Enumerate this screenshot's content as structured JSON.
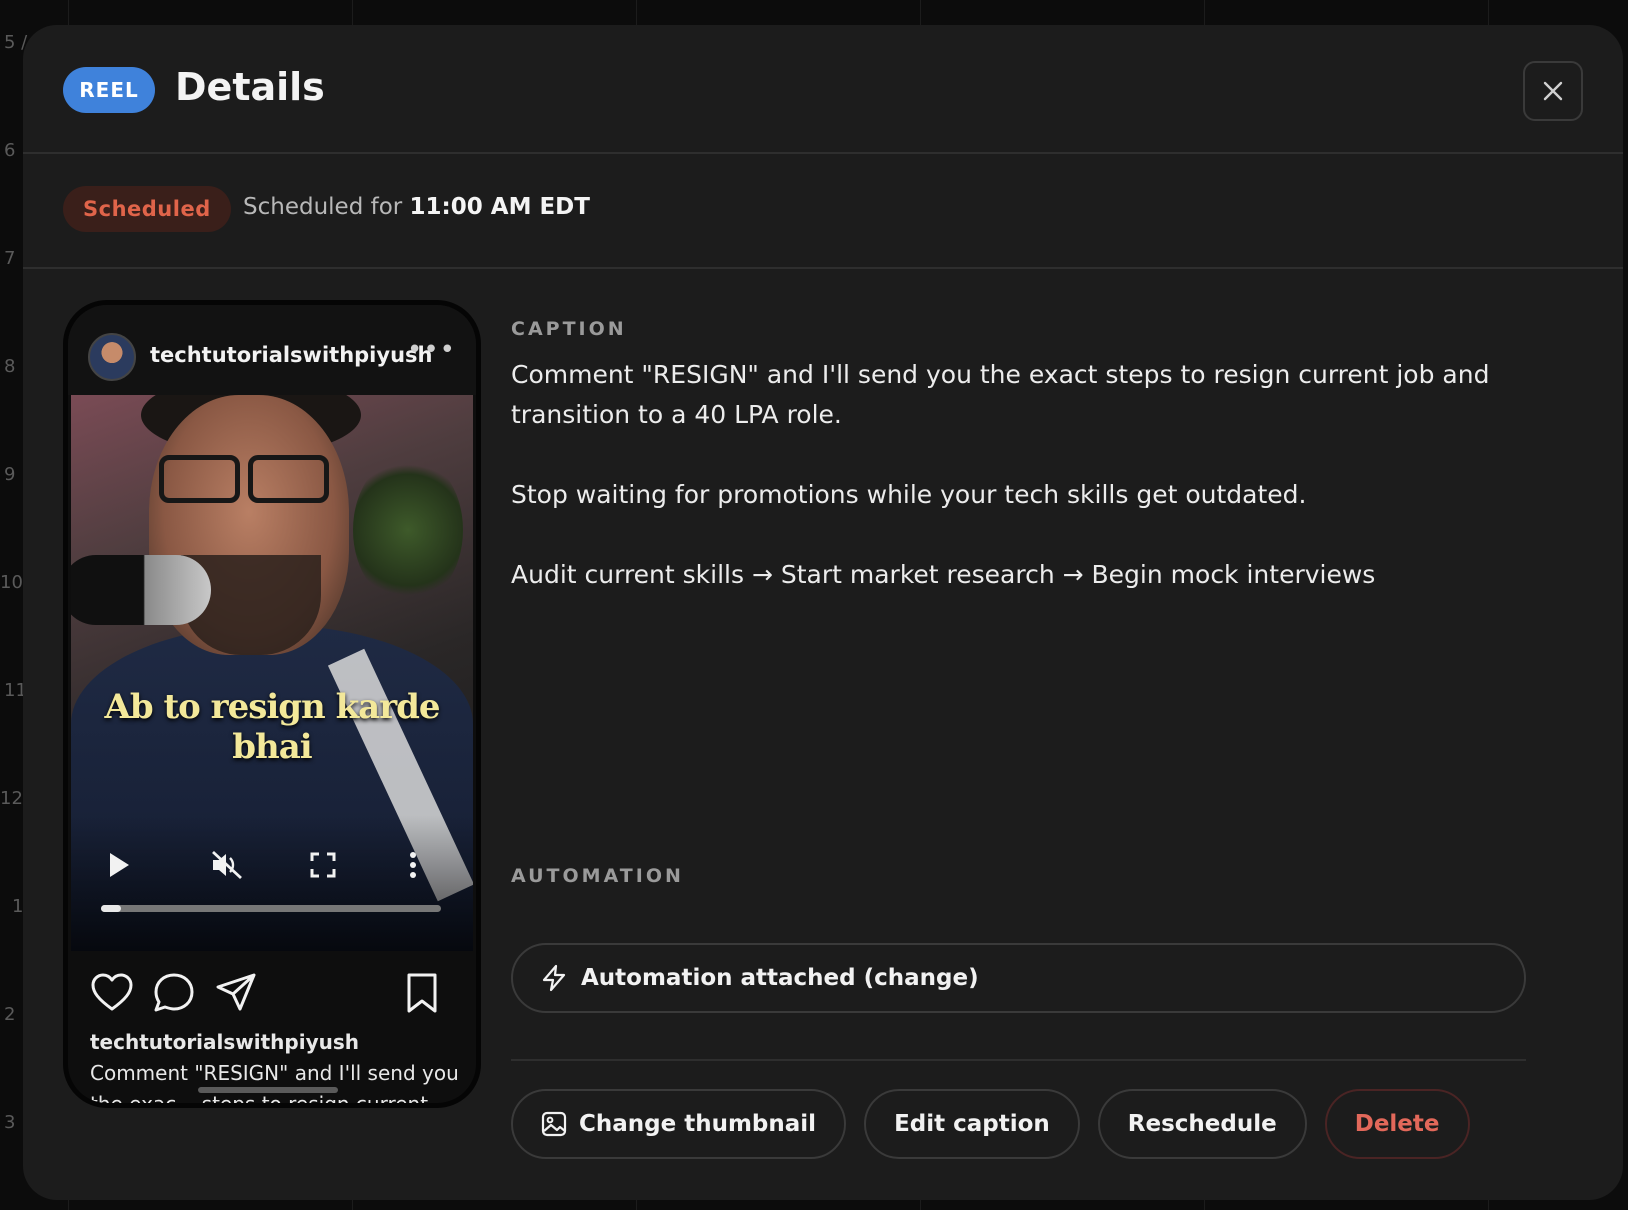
{
  "background": {
    "hour_labels": [
      "5 /",
      "6",
      "7",
      "8",
      "9",
      "10",
      "11",
      "12",
      "1",
      "2",
      "3"
    ]
  },
  "modal": {
    "badge": "REEL",
    "title": "Details",
    "status": {
      "badge": "Scheduled",
      "prefix": "Scheduled for ",
      "time": "11:00 AM EDT"
    },
    "preview": {
      "username": "techtutorialswithpiyush",
      "more": "•••",
      "subtitle": "Ab to resign karde bhai",
      "progress_fraction": 0.06,
      "caption_username": "techtutorialswithpiyush",
      "caption_text": " Comment \"RESIGN\" and I'll send you the exac... steps to resign current job and"
    },
    "caption": {
      "label": "CAPTION",
      "text": "Comment \"RESIGN\" and I'll send you the exact steps to resign current job and transition to a 40 LPA role.\n\nStop waiting for promotions while your tech skills get outdated.\n\nAudit current skills → Start market research → Begin mock interviews"
    },
    "automation": {
      "label": "AUTOMATION",
      "button": "Automation attached (change)"
    },
    "actions": {
      "change_thumbnail": "Change thumbnail",
      "edit_caption": "Edit caption",
      "reschedule": "Reschedule",
      "delete": "Delete"
    }
  }
}
